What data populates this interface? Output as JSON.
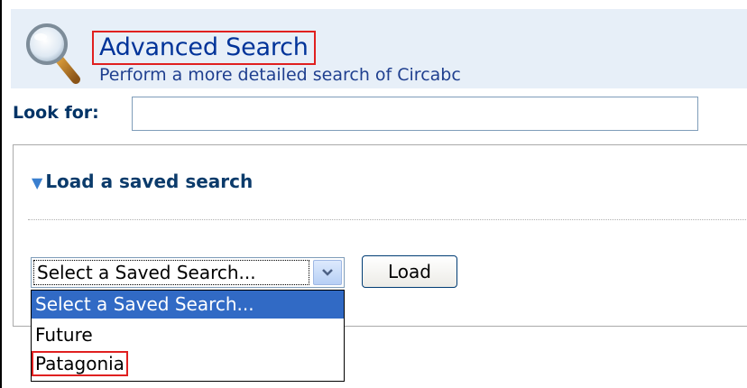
{
  "header": {
    "title": "Advanced Search",
    "subtitle": "Perform a more detailed search of Circabc",
    "icon": "magnifier-icon"
  },
  "search": {
    "label": "Look for:",
    "value": "",
    "placeholder": ""
  },
  "saved_search": {
    "toggle_label": "Load a saved search",
    "toggle_icon": "triangle-down-icon",
    "select_value": "Select a Saved Search...",
    "load_label": "Load",
    "options": [
      "Select a Saved Search...",
      "Future",
      "Patagonia"
    ]
  },
  "colors": {
    "header_bg": "#e7eff8",
    "title": "#003399",
    "highlight": "#e02020",
    "selected_option": "#316ac5"
  }
}
